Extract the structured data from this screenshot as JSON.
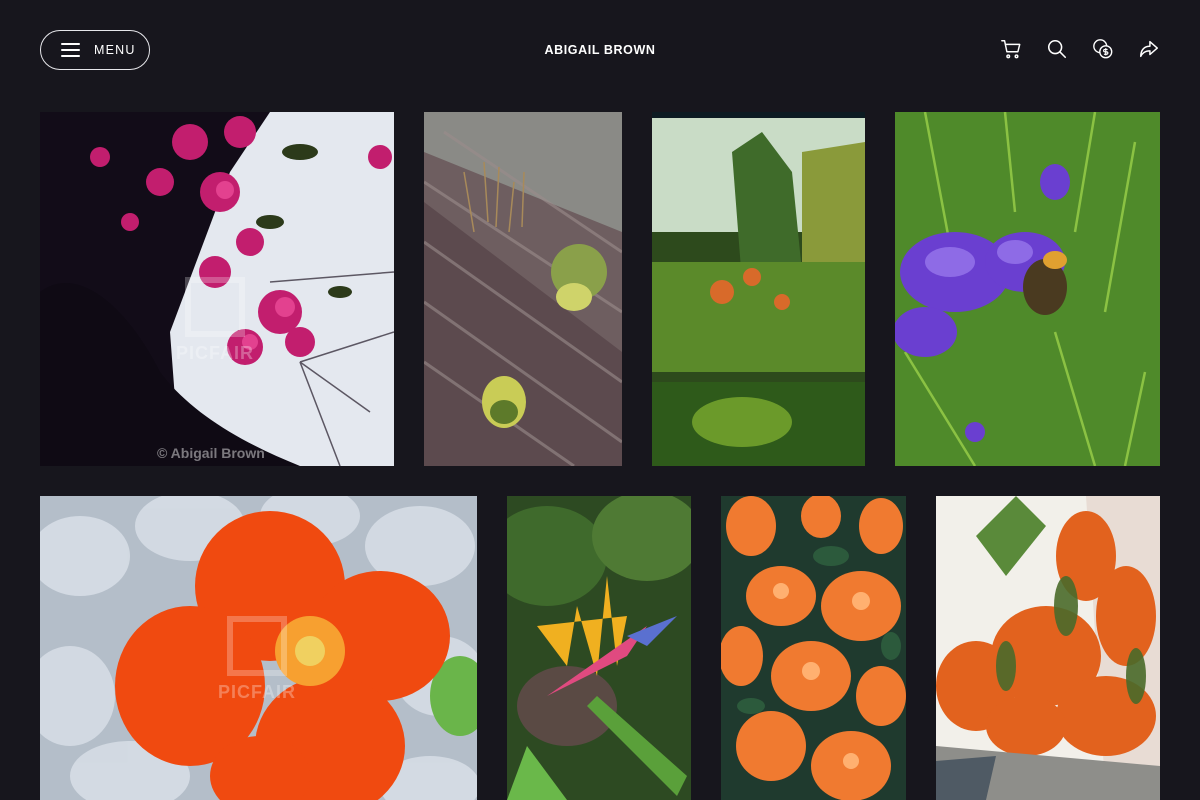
{
  "header": {
    "menu_label": "MENU",
    "site_title": "ABIGAIL BROWN",
    "icons": [
      "cart-icon",
      "search-icon",
      "currency-icon",
      "share-icon"
    ]
  },
  "gallery": {
    "photos": [
      {
        "subject": "bougainvillea",
        "watermark_text": "© Abigail Brown",
        "watermark_logo": "PICFAIR"
      },
      {
        "subject": "rock-face-plants"
      },
      {
        "subject": "garden-through-glass"
      },
      {
        "subject": "lavender-bee"
      },
      {
        "subject": "orange-nasturtium",
        "watermark_logo": "PICFAIR"
      },
      {
        "subject": "bird-of-paradise"
      },
      {
        "subject": "orange-trumpet-flowers"
      },
      {
        "subject": "flame-vine-wall"
      }
    ]
  },
  "colors": {
    "background": "#17161d",
    "text": "#ffffff"
  }
}
